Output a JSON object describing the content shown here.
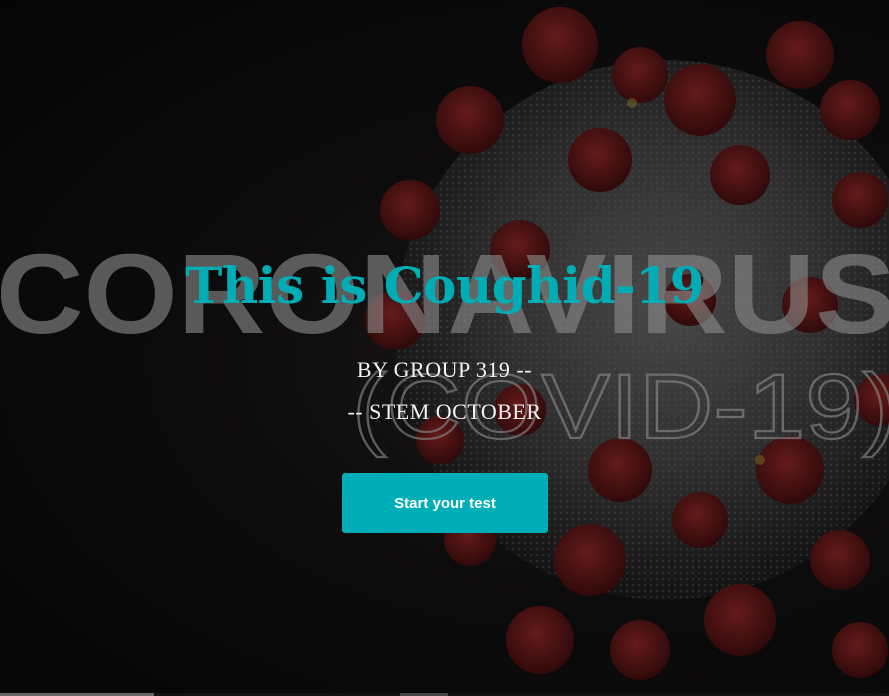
{
  "hero": {
    "background_word_1": "CORONAVIRUS",
    "background_word_2": "(COVID-19)",
    "title": "This is Coughid-19",
    "subtitle_line_1": "BY GROUP 319 --",
    "subtitle_line_2": "-- STEM OCTOBER",
    "cta_label": "Start your test"
  },
  "colors": {
    "accent": "#00adb5",
    "background": "#0c0b0b",
    "virus_spike": "#7a1e1e",
    "virus_body": "#5e5e5e"
  },
  "icons": {
    "background_illustration": "coronavirus-particle-illustration"
  }
}
